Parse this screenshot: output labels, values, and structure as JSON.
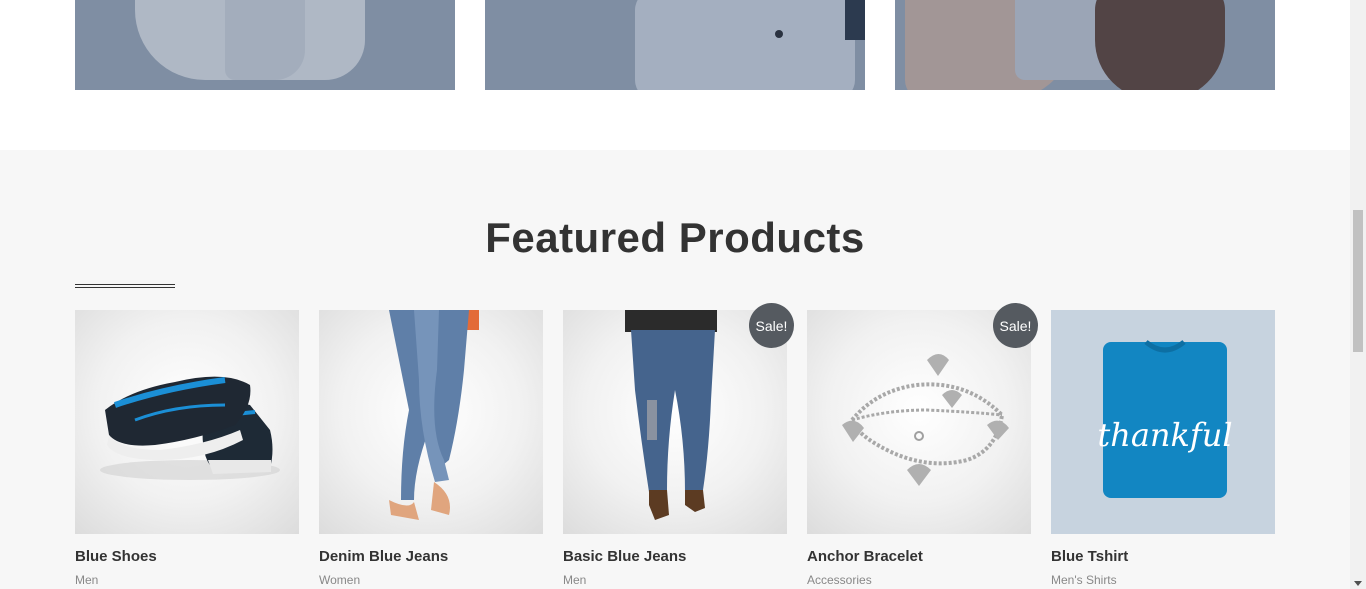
{
  "featured": {
    "title": "Featured Products",
    "products": [
      {
        "name": "Blue Shoes",
        "category": "Men",
        "sale": ""
      },
      {
        "name": "Denim Blue Jeans",
        "category": "Women",
        "sale": ""
      },
      {
        "name": "Basic Blue Jeans",
        "category": "Men",
        "sale": "Sale!"
      },
      {
        "name": "Anchor Bracelet",
        "category": "Accessories",
        "sale": "Sale!"
      },
      {
        "name": "Blue Tshirt",
        "category": "Men's Shirts",
        "sale": ""
      }
    ],
    "tshirt_print": "thankful"
  },
  "colors": {
    "section_bg": "#f7f7f7",
    "title": "#333333",
    "sale_badge": "#555a60"
  }
}
